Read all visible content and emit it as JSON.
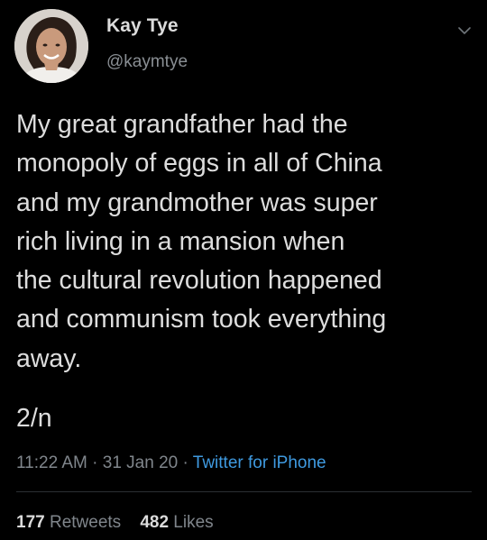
{
  "author": {
    "name": "Kay Tye",
    "handle": "@kaymtye"
  },
  "tweet": {
    "text": "My great grandfather had the\nmonopoly of eggs in all of China\nand my grandmother was super\nrich living in a mansion when\nthe cultural revolution happened\nand communism took everything\naway.",
    "thread_marker": "2/n",
    "time": "11:22 AM",
    "date": "31 Jan 20",
    "separator": "·",
    "source": "Twitter for iPhone"
  },
  "stats": {
    "retweets_count": "177",
    "retweets_label": "Retweets",
    "likes_count": "482",
    "likes_label": "Likes"
  },
  "icons": {
    "menu": "chevron-down-icon"
  },
  "colors": {
    "background": "#000000",
    "link": "#3f9ae0",
    "secondary_text": "#80868c"
  }
}
